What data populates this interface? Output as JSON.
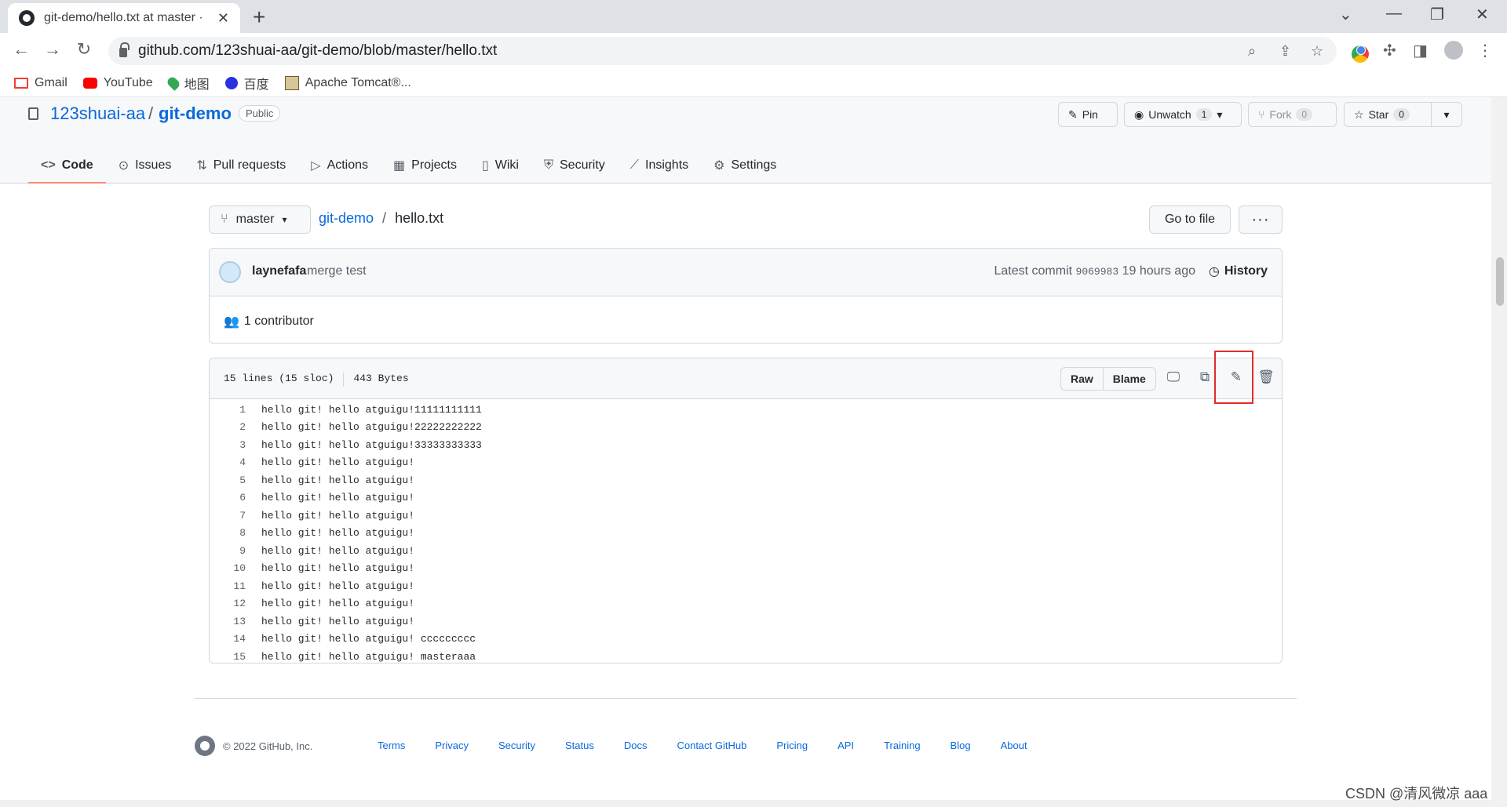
{
  "browser": {
    "tab_title": "git-demo/hello.txt at master ·",
    "url": "github.com/123shuai-aa/git-demo/blob/master/hello.txt",
    "bookmarks": [
      "Gmail",
      "YouTube",
      "地图",
      "百度",
      "Apache Tomcat®..."
    ]
  },
  "repo": {
    "owner": "123shuai-aa",
    "separator": "/",
    "name": "git-demo",
    "visibility": "Public",
    "pin_label": "Pin",
    "unwatch_label": "Unwatch",
    "unwatch_count": "1",
    "fork_label": "Fork",
    "fork_count": "0",
    "star_label": "Star",
    "star_count": "0",
    "nav": [
      "Code",
      "Issues",
      "Pull requests",
      "Actions",
      "Projects",
      "Wiki",
      "Security",
      "Insights",
      "Settings"
    ]
  },
  "file": {
    "branch": "master",
    "crumb_repo": "git-demo",
    "crumb_sep": "/",
    "crumb_file": "hello.txt",
    "goto_label": "Go to file",
    "more_label": "···",
    "commit_author": "laynefafa",
    "commit_message": "merge test",
    "latest_label": "Latest commit",
    "commit_sha": "9069983",
    "commit_time": "19 hours ago",
    "history_label": "History",
    "contributors": "1 contributor",
    "lines_info": "15 lines (15 sloc)",
    "size_info": "443 Bytes",
    "raw_label": "Raw",
    "blame_label": "Blame",
    "lines": [
      "hello git! hello atguigu!11111111111",
      "hello git! hello atguigu!22222222222",
      "hello git! hello atguigu!33333333333",
      "hello git! hello atguigu!",
      "hello git! hello atguigu!",
      "hello git! hello atguigu!",
      "hello git! hello atguigu!",
      "hello git! hello atguigu!",
      "hello git! hello atguigu!",
      "hello git! hello atguigu!",
      "hello git! hello atguigu!",
      "hello git! hello atguigu!",
      "hello git! hello atguigu!",
      "hello git! hello atguigu! ccccccccc",
      "hello git! hello atguigu! masteraaa"
    ]
  },
  "footer": {
    "copyright": "© 2022 GitHub, Inc.",
    "links": [
      "Terms",
      "Privacy",
      "Security",
      "Status",
      "Docs",
      "Contact GitHub",
      "Pricing",
      "API",
      "Training",
      "Blog",
      "About"
    ]
  },
  "watermark": "CSDN @清风微凉 aaa"
}
